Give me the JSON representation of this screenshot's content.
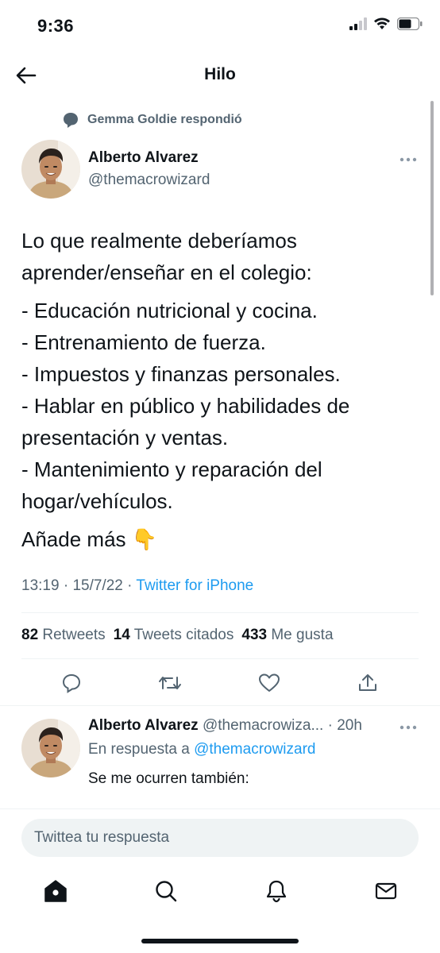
{
  "status_bar": {
    "time": "9:36"
  },
  "header": {
    "title": "Hilo"
  },
  "context": {
    "text": "Gemma Goldie respondió"
  },
  "tweet": {
    "author_name": "Alberto Alvarez",
    "author_handle": "@themacrowizard",
    "lines_intro": [
      "Lo que realmente deberíamos",
      "aprender/enseñar en el colegio:"
    ],
    "lines_list": [
      "- Educación nutricional y cocina.",
      "- Entrenamiento de fuerza.",
      "- Impuestos y finanzas personales.",
      "- Hablar en público y habilidades de",
      "presentación y ventas.",
      "- Mantenimiento y reparación del",
      "hogar/vehículos."
    ],
    "closing": "Añade más 👇",
    "time": "13:19",
    "date": "15/7/22",
    "source": "Twitter for iPhone",
    "retweets_count": "82",
    "retweets_label": "Retweets",
    "quotes_count": "14",
    "quotes_label": "Tweets citados",
    "likes_count": "433",
    "likes_label": "Me gusta"
  },
  "reply": {
    "author_name": "Alberto Alvarez",
    "author_handle": "@themacrowiza...",
    "age": "20h",
    "reply_to_label": "En respuesta a",
    "reply_to_handle": "@themacrowizard",
    "text": "Se me ocurren también:"
  },
  "compose": {
    "placeholder": "Twittea tu respuesta"
  },
  "icons": {
    "back": "arrow-left-icon",
    "more": "ellipsis-icon",
    "reply": "speech-bubble-icon",
    "retweet": "retweet-icon",
    "like": "heart-icon",
    "share": "share-icon",
    "home": "home-icon",
    "search": "search-icon",
    "notifications": "bell-icon",
    "messages": "mail-icon"
  },
  "colors": {
    "accent": "#1d9bf0",
    "secondary_text": "#536471",
    "primary_text": "#0f1419"
  }
}
